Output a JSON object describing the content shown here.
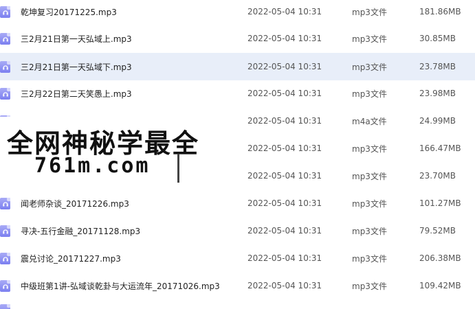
{
  "files": [
    {
      "name": "乾坤复习20171225.mp3",
      "date": "2022-05-04 10:31",
      "type": "mp3文件",
      "size": "181.86MB",
      "icon": "audio-file-icon"
    },
    {
      "name": "三2月21日第一天弘域上.mp3",
      "date": "2022-05-04 10:31",
      "type": "mp3文件",
      "size": "30.85MB",
      "icon": "audio-file-icon"
    },
    {
      "name": "三2月21日第一天弘域下.mp3",
      "date": "2022-05-04 10:31",
      "type": "mp3文件",
      "size": "23.78MB",
      "icon": "audio-file-icon",
      "selected": true
    },
    {
      "name": "三2月22日第二天笑愚上.mp3",
      "date": "2022-05-04 10:31",
      "type": "mp3文件",
      "size": "23.98MB",
      "icon": "audio-file-icon"
    },
    {
      "name": "",
      "date": "2022-05-04 10:31",
      "type": "m4a文件",
      "size": "24.99MB",
      "icon": "audio-file-icon"
    },
    {
      "name": "",
      "date": "2022-05-04 10:31",
      "type": "mp3文件",
      "size": "166.47MB",
      "icon": "audio-file-icon"
    },
    {
      "name": "",
      "date": "2022-05-04 10:31",
      "type": "mp3文件",
      "size": "23.70MB",
      "icon": "audio-file-icon"
    },
    {
      "name": "闻老师杂谈_20171226.mp3",
      "date": "2022-05-04 10:31",
      "type": "mp3文件",
      "size": "101.27MB",
      "icon": "audio-file-icon"
    },
    {
      "name": "寻决-五行金融_20171128.mp3",
      "date": "2022-05-04 10:31",
      "type": "mp3文件",
      "size": "79.52MB",
      "icon": "audio-file-icon"
    },
    {
      "name": "震兑讨论_20171227.mp3",
      "date": "2022-05-04 10:31",
      "type": "mp3文件",
      "size": "206.38MB",
      "icon": "audio-file-icon"
    },
    {
      "name": "中级班第1讲-弘域谈乾卦与大运流年_20171026.mp3",
      "date": "2022-05-04 10:31",
      "type": "mp3文件",
      "size": "109.42MB",
      "icon": "audio-file-icon"
    }
  ],
  "watermark": {
    "line1": "全网神秘学最全",
    "line2": "761m.com"
  }
}
